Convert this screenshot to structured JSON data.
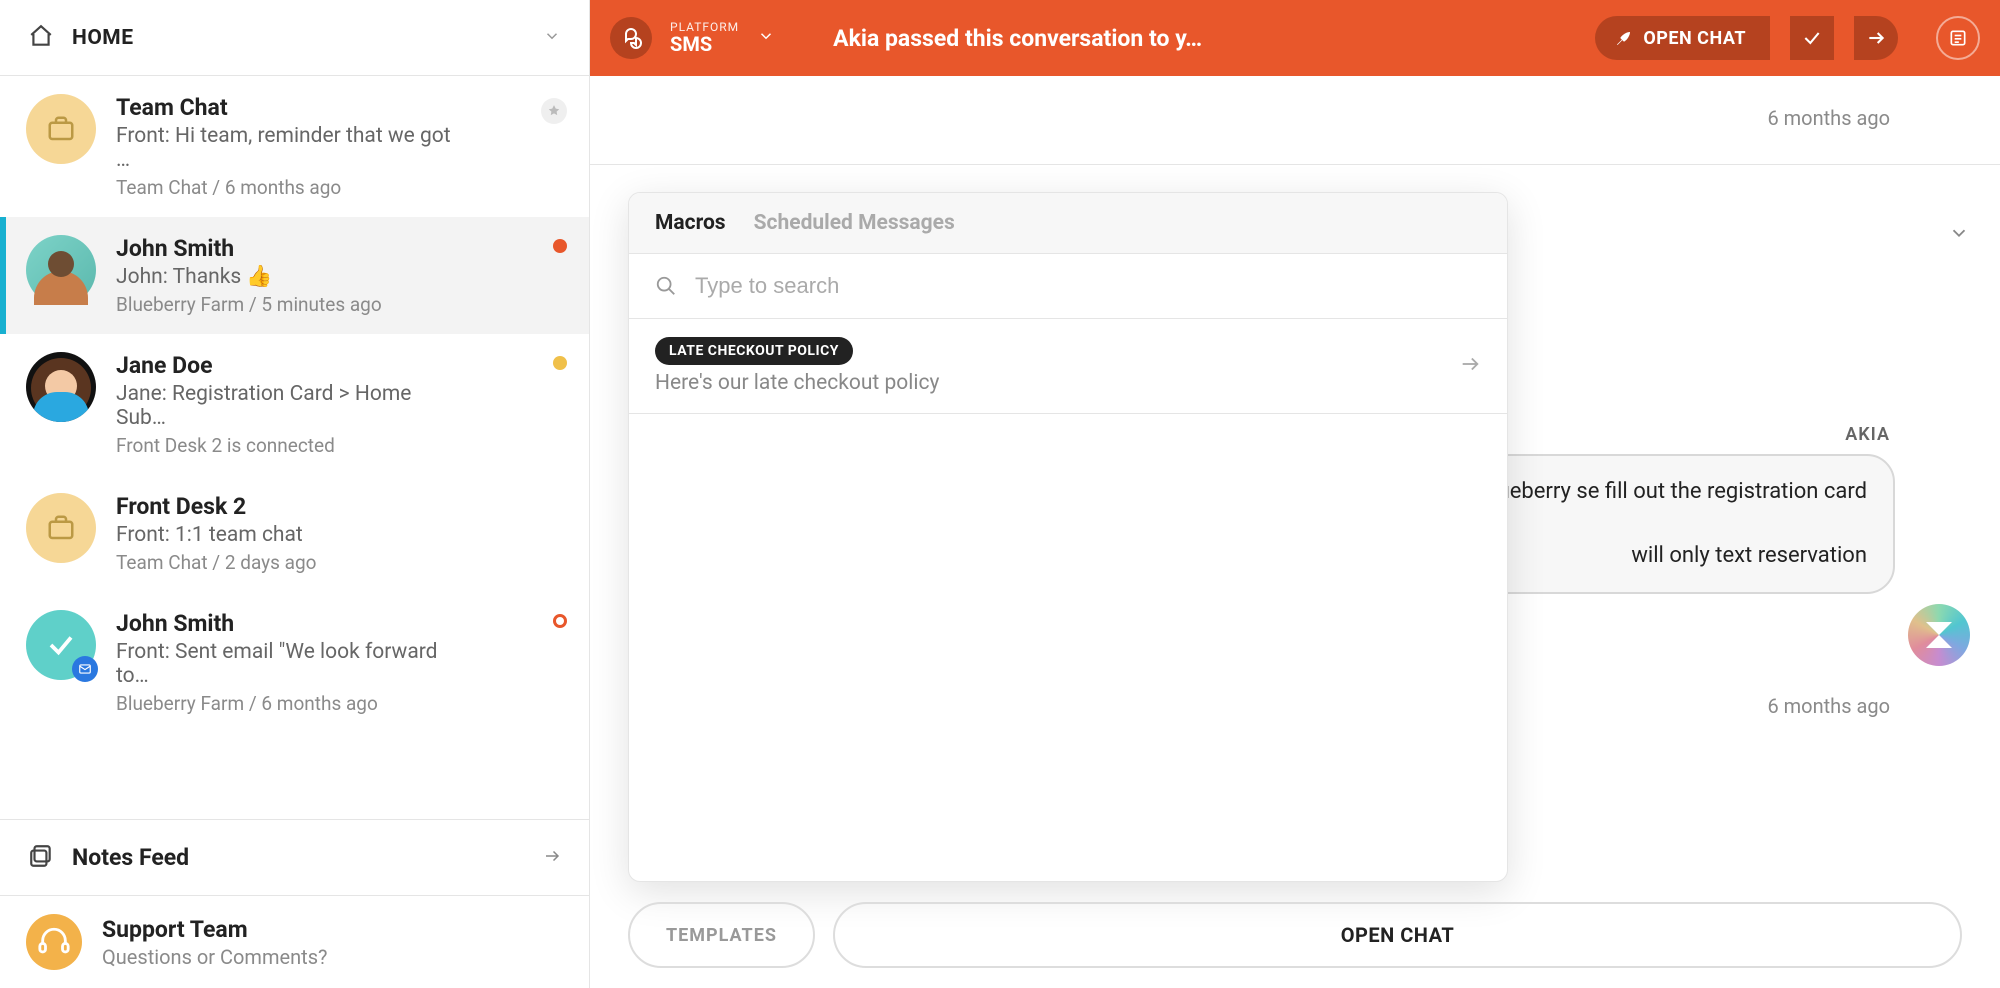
{
  "sidebar": {
    "home": "HOME",
    "items": [
      {
        "title": "Team Chat",
        "preview": "Front: Hi team, reminder that we got …",
        "meta": "Team Chat / 6 months ago"
      },
      {
        "title": "John Smith",
        "preview": "John: Thanks 👍",
        "meta": "Blueberry Farm / 5 minutes ago"
      },
      {
        "title": "Jane Doe",
        "preview": "Jane: Registration Card > Home Sub…",
        "meta": "Front Desk 2 is connected"
      },
      {
        "title": "Front Desk 2",
        "preview": "Front: 1:1 team chat",
        "meta": "Team Chat / 2 days ago"
      },
      {
        "title": "John Smith",
        "preview": "Front: Sent email \"We look forward to…",
        "meta": "Blueberry Farm / 6 months ago"
      }
    ],
    "notes": "Notes Feed",
    "support": {
      "title": "Support Team",
      "sub": "Questions or Comments?"
    }
  },
  "topbar": {
    "platform_label": "PLATFORM",
    "platform_value": "SMS",
    "title": "Akia passed this conversation to y…",
    "open_chat": "OPEN CHAT"
  },
  "chat": {
    "top_time": "6 months ago",
    "akia_label": "AKIA",
    "bubble": "to your arrival today at Blueberry se fill out the registration card\n\nwill only text reservation",
    "mid_time": "6 months ago"
  },
  "panel": {
    "tab_macros": "Macros",
    "tab_scheduled": "Scheduled Messages",
    "search_placeholder": "Type to search",
    "macro": {
      "name": "LATE CHECKOUT POLICY",
      "desc": "Here's our late checkout policy"
    }
  },
  "bottom": {
    "templates": "TEMPLATES",
    "open_chat": "OPEN CHAT"
  }
}
